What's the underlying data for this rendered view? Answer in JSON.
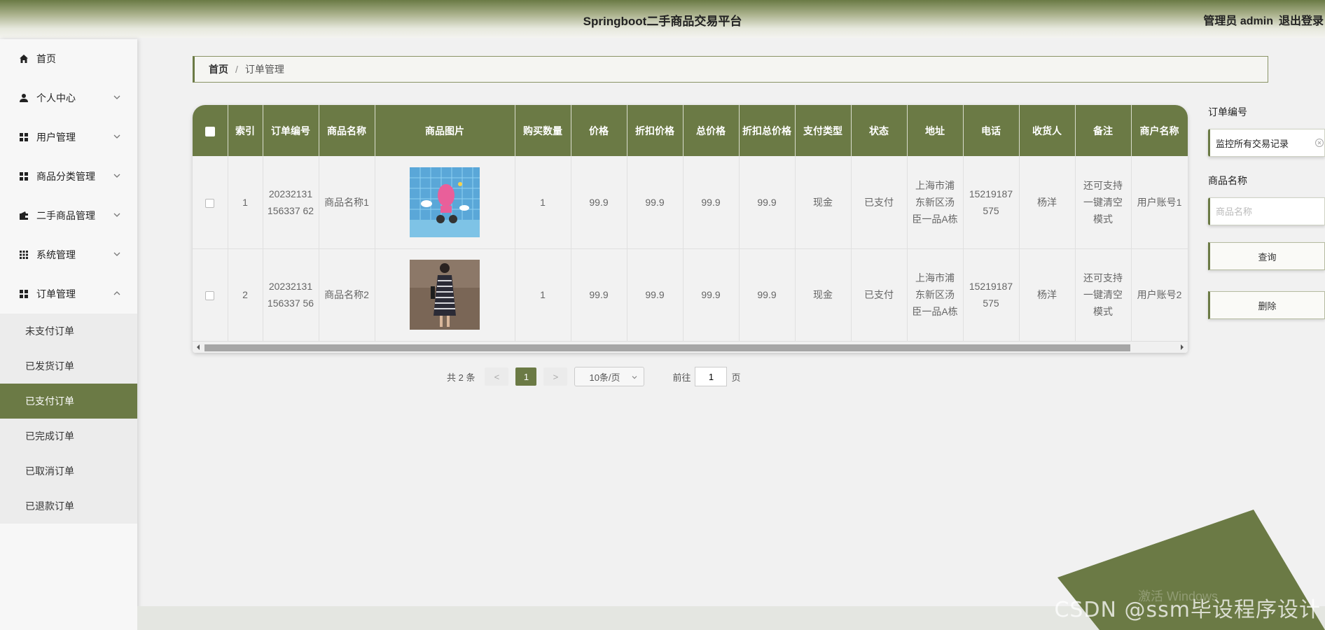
{
  "header": {
    "title": "Springboot二手商品交易平台",
    "user_label": "管理员 admin",
    "logout": "退出登录"
  },
  "sidebar": {
    "items": [
      {
        "label": "首页",
        "icon": "home-icon"
      },
      {
        "label": "个人中心",
        "icon": "user-icon"
      },
      {
        "label": "用户管理",
        "icon": "grid-icon"
      },
      {
        "label": "商品分类管理",
        "icon": "grid-icon"
      },
      {
        "label": "二手商品管理",
        "icon": "wallet-icon"
      },
      {
        "label": "系统管理",
        "icon": "grid9-icon"
      },
      {
        "label": "订单管理",
        "icon": "grid-icon"
      }
    ],
    "order_sub": [
      "未支付订单",
      "已发货订单",
      "已支付订单",
      "已完成订单",
      "已取消订单",
      "已退款订单"
    ],
    "active_sub": "已支付订单"
  },
  "breadcrumb": {
    "home": "首页",
    "separator": "/",
    "current": "订单管理"
  },
  "table": {
    "headers": [
      "索引",
      "订单编号",
      "商品名称",
      "商品图片",
      "购买数量",
      "价格",
      "折扣价格",
      "总价格",
      "折扣总价格",
      "支付类型",
      "状态",
      "地址",
      "电话",
      "收货人",
      "备注",
      "商户名称"
    ],
    "rows": [
      {
        "index": "1",
        "order_no": "20232131156337 62",
        "name": "商品名称1",
        "qty": "1",
        "price": "99.9",
        "discount_price": "99.9",
        "total": "99.9",
        "discount_total": "99.9",
        "pay_type": "现金",
        "status": "已支付",
        "address": "上海市浦东新区汤臣一品A栋",
        "phone": "15219187575",
        "receiver": "杨洋",
        "note": "还可支持一键清空模式",
        "merchant": "用户账号1"
      },
      {
        "index": "2",
        "order_no": "20232131156337 56",
        "name": "商品名称2",
        "qty": "1",
        "price": "99.9",
        "discount_price": "99.9",
        "total": "99.9",
        "discount_total": "99.9",
        "pay_type": "现金",
        "status": "已支付",
        "address": "上海市浦东新区汤臣一品A栋",
        "phone": "15219187575",
        "receiver": "杨洋",
        "note": "还可支持一键清空模式",
        "merchant": "用户账号2"
      }
    ]
  },
  "pagination": {
    "total": "共 2 条",
    "prev": "<",
    "next": ">",
    "current_page": "1",
    "page_size": "10条/页",
    "goto_label": "前往",
    "goto_value": "1",
    "page_suffix": "页"
  },
  "search": {
    "order_no_label": "订单编号",
    "order_no_value": "监控所有交易记录",
    "name_label": "商品名称",
    "name_placeholder": "商品名称",
    "query_button": "查询",
    "delete_button": "删除"
  },
  "overlay": {
    "watermark": "CSDN @ssm毕设程序设计",
    "activate_hint": "激活 Windows"
  },
  "colors": {
    "accent": "#6b7a45"
  }
}
